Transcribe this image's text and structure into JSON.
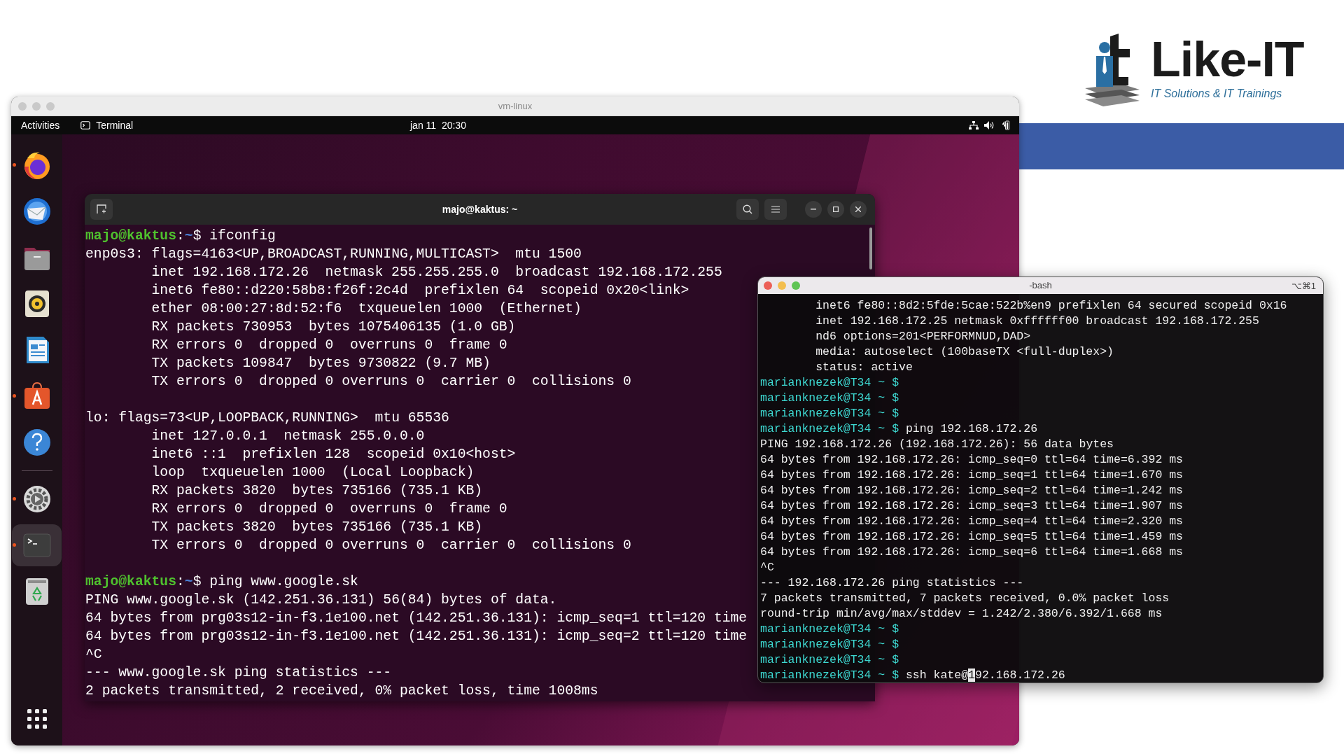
{
  "logo": {
    "name": "Like-IT",
    "tagline": "IT Solutions & IT Trainings"
  },
  "vm_window": {
    "title": "vm-linux"
  },
  "top_bar": {
    "activities": "Activities",
    "app": "Terminal",
    "clock": "jan 11  20:30"
  },
  "dock": {
    "items": [
      {
        "kind": "browser",
        "running": true,
        "selected": false
      },
      {
        "kind": "mail",
        "running": false,
        "selected": false
      },
      {
        "kind": "files",
        "running": false,
        "selected": false
      },
      {
        "kind": "music",
        "running": false,
        "selected": false
      },
      {
        "kind": "writer",
        "running": false,
        "selected": false
      },
      {
        "kind": "store",
        "running": true,
        "selected": false
      },
      {
        "kind": "help",
        "running": false,
        "selected": false
      },
      {
        "kind": "separator"
      },
      {
        "kind": "settings",
        "running": true,
        "selected": false
      },
      {
        "kind": "terminal",
        "running": true,
        "selected": true
      },
      {
        "kind": "trash",
        "running": false,
        "selected": false
      }
    ]
  },
  "linux_terminal": {
    "title": "majo@kaktus: ~",
    "lines": [
      {
        "kind": "prompt",
        "user": "majo@kaktus",
        "sep": ":",
        "path": "~",
        "command": "$ ifconfig"
      },
      {
        "kind": "output",
        "text": "enp0s3: flags=4163<UP,BROADCAST,RUNNING,MULTICAST>  mtu 1500"
      },
      {
        "kind": "indented",
        "text": "inet 192.168.172.26  netmask 255.255.255.0  broadcast 192.168.172.255"
      },
      {
        "kind": "indented",
        "text": "inet6 fe80::d220:58b8:f26f:2c4d  prefixlen 64  scopeid 0x20<link>"
      },
      {
        "kind": "indented",
        "text": "ether 08:00:27:8d:52:f6  txqueuelen 1000  (Ethernet)"
      },
      {
        "kind": "indented",
        "text": "RX packets 730953  bytes 1075406135 (1.0 GB)"
      },
      {
        "kind": "indented",
        "text": "RX errors 0  dropped 0  overruns 0  frame 0"
      },
      {
        "kind": "indented",
        "text": "TX packets 109847  bytes 9730822 (9.7 MB)"
      },
      {
        "kind": "indented",
        "text": "TX errors 0  dropped 0 overruns 0  carrier 0  collisions 0"
      },
      {
        "kind": "blank"
      },
      {
        "kind": "output",
        "text": "lo: flags=73<UP,LOOPBACK,RUNNING>  mtu 65536"
      },
      {
        "kind": "indented",
        "text": "inet 127.0.0.1  netmask 255.0.0.0"
      },
      {
        "kind": "indented",
        "text": "inet6 ::1  prefixlen 128  scopeid 0x10<host>"
      },
      {
        "kind": "indented",
        "text": "loop  txqueuelen 1000  (Local Loopback)"
      },
      {
        "kind": "indented",
        "text": "RX packets 3820  bytes 735166 (735.1 KB)"
      },
      {
        "kind": "indented",
        "text": "RX errors 0  dropped 0  overruns 0  frame 0"
      },
      {
        "kind": "indented",
        "text": "TX packets 3820  bytes 735166 (735.1 KB)"
      },
      {
        "kind": "indented",
        "text": "TX errors 0  dropped 0 overruns 0  carrier 0  collisions 0"
      },
      {
        "kind": "blank"
      },
      {
        "kind": "prompt",
        "user": "majo@kaktus",
        "sep": ":",
        "path": "~",
        "command": "$ ping www.google.sk"
      },
      {
        "kind": "output",
        "text": "PING www.google.sk (142.251.36.131) 56(84) bytes of data."
      },
      {
        "kind": "output",
        "text": "64 bytes from prg03s12-in-f3.1e100.net (142.251.36.131): icmp_seq=1 ttl=120 time"
      },
      {
        "kind": "output",
        "text": "64 bytes from prg03s12-in-f3.1e100.net (142.251.36.131): icmp_seq=2 ttl=120 time"
      },
      {
        "kind": "output",
        "text": "^C"
      },
      {
        "kind": "output",
        "text": "--- www.google.sk ping statistics ---"
      },
      {
        "kind": "output",
        "text": "2 packets transmitted, 2 received, 0% packet loss, time 1008ms"
      }
    ]
  },
  "mac_terminal": {
    "title": "-bash",
    "shortcut": "⌥⌘1",
    "lines": [
      {
        "kind": "indented",
        "text": "inet6 fe80::8d2:5fde:5cae:522b%en9 prefixlen 64 secured scopeid 0x16"
      },
      {
        "kind": "indented",
        "text": "inet 192.168.172.25 netmask 0xffffff00 broadcast 192.168.172.255"
      },
      {
        "kind": "indented",
        "text": "nd6 options=201<PERFORMNUD,DAD>"
      },
      {
        "kind": "indented",
        "text": "media: autoselect (100baseTX <full-duplex>)"
      },
      {
        "kind": "indented",
        "text": "status: active"
      },
      {
        "kind": "prompt",
        "user": "marianknezek@T34 ~ $"
      },
      {
        "kind": "prompt",
        "user": "marianknezek@T34 ~ $"
      },
      {
        "kind": "prompt",
        "user": "marianknezek@T34 ~ $"
      },
      {
        "kind": "prompt",
        "user": "marianknezek@T34 ~ $",
        "command": "ping 192.168.172.26"
      },
      {
        "kind": "output",
        "text": "PING 192.168.172.26 (192.168.172.26): 56 data bytes"
      },
      {
        "kind": "output",
        "text": "64 bytes from 192.168.172.26: icmp_seq=0 ttl=64 time=6.392 ms"
      },
      {
        "kind": "output",
        "text": "64 bytes from 192.168.172.26: icmp_seq=1 ttl=64 time=1.670 ms"
      },
      {
        "kind": "output",
        "text": "64 bytes from 192.168.172.26: icmp_seq=2 ttl=64 time=1.242 ms"
      },
      {
        "kind": "output",
        "text": "64 bytes from 192.168.172.26: icmp_seq=3 ttl=64 time=1.907 ms"
      },
      {
        "kind": "output",
        "text": "64 bytes from 192.168.172.26: icmp_seq=4 ttl=64 time=2.320 ms"
      },
      {
        "kind": "output",
        "text": "64 bytes from 192.168.172.26: icmp_seq=5 ttl=64 time=1.459 ms"
      },
      {
        "kind": "output",
        "text": "64 bytes from 192.168.172.26: icmp_seq=6 ttl=64 time=1.668 ms"
      },
      {
        "kind": "output",
        "text": "^C"
      },
      {
        "kind": "output",
        "text": "--- 192.168.172.26 ping statistics ---"
      },
      {
        "kind": "output",
        "text": "7 packets transmitted, 7 packets received, 0.0% packet loss"
      },
      {
        "kind": "output",
        "text": "round-trip min/avg/max/stddev = 1.242/2.380/6.392/1.668 ms"
      },
      {
        "kind": "prompt",
        "user": "marianknezek@T34 ~ $"
      },
      {
        "kind": "prompt",
        "user": "marianknezek@T34 ~ $"
      },
      {
        "kind": "prompt",
        "user": "marianknezek@T34 ~ $"
      },
      {
        "kind": "prompt",
        "user": "marianknezek@T34 ~ $",
        "command": "ssh kate@",
        "cursor_on": "1",
        "after_cursor": "92.168.172.26"
      }
    ]
  }
}
